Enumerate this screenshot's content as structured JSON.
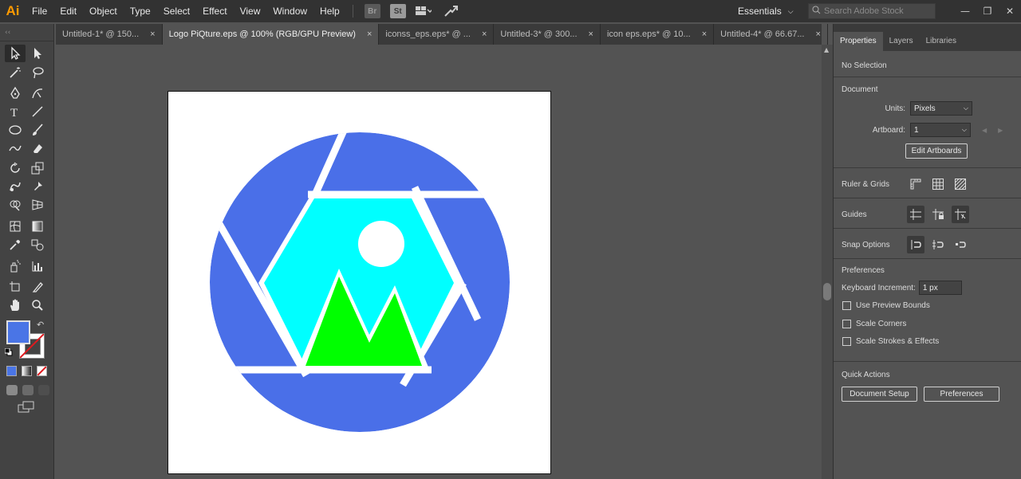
{
  "app": {
    "logo": "Ai"
  },
  "menu": [
    "File",
    "Edit",
    "Object",
    "Type",
    "Select",
    "Effect",
    "View",
    "Window",
    "Help"
  ],
  "menubar_buttons": {
    "br": "Br",
    "st": "St"
  },
  "workspace": {
    "label": "Essentials"
  },
  "search": {
    "placeholder": "Search Adobe Stock"
  },
  "tabs": [
    {
      "label": "Untitled-1* @ 150..."
    },
    {
      "label": "Logo PiQture.eps @ 100% (RGB/GPU Preview)"
    },
    {
      "label": "iconss_eps.eps* @ ..."
    },
    {
      "label": "Untitled-3* @ 300..."
    },
    {
      "label": "icon eps.eps* @ 10..."
    },
    {
      "label": "Untitled-4* @ 66.67..."
    }
  ],
  "tab_close": "×",
  "colors": {
    "fill": "#4a75e6",
    "logo_blue": "#4a6fe8",
    "logo_cyan": "#00ffff",
    "logo_green": "#00ff00",
    "logo_white": "#ffffff"
  },
  "panel": {
    "tabs": [
      "Properties",
      "Layers",
      "Libraries"
    ],
    "no_selection": "No Selection",
    "document": {
      "title": "Document",
      "units_label": "Units:",
      "units_value": "Pixels",
      "artboard_label": "Artboard:",
      "artboard_value": "1",
      "edit_artboards": "Edit Artboards"
    },
    "ruler_grids": "Ruler & Grids",
    "guides": "Guides",
    "snap_options": "Snap Options",
    "preferences": {
      "title": "Preferences",
      "keyboard_increment_label": "Keyboard Increment:",
      "keyboard_increment_value": "1 px",
      "use_preview_bounds": "Use Preview Bounds",
      "scale_corners": "Scale Corners",
      "scale_strokes": "Scale Strokes & Effects"
    },
    "quick_actions": {
      "title": "Quick Actions",
      "document_setup": "Document Setup",
      "preferences": "Preferences"
    }
  }
}
